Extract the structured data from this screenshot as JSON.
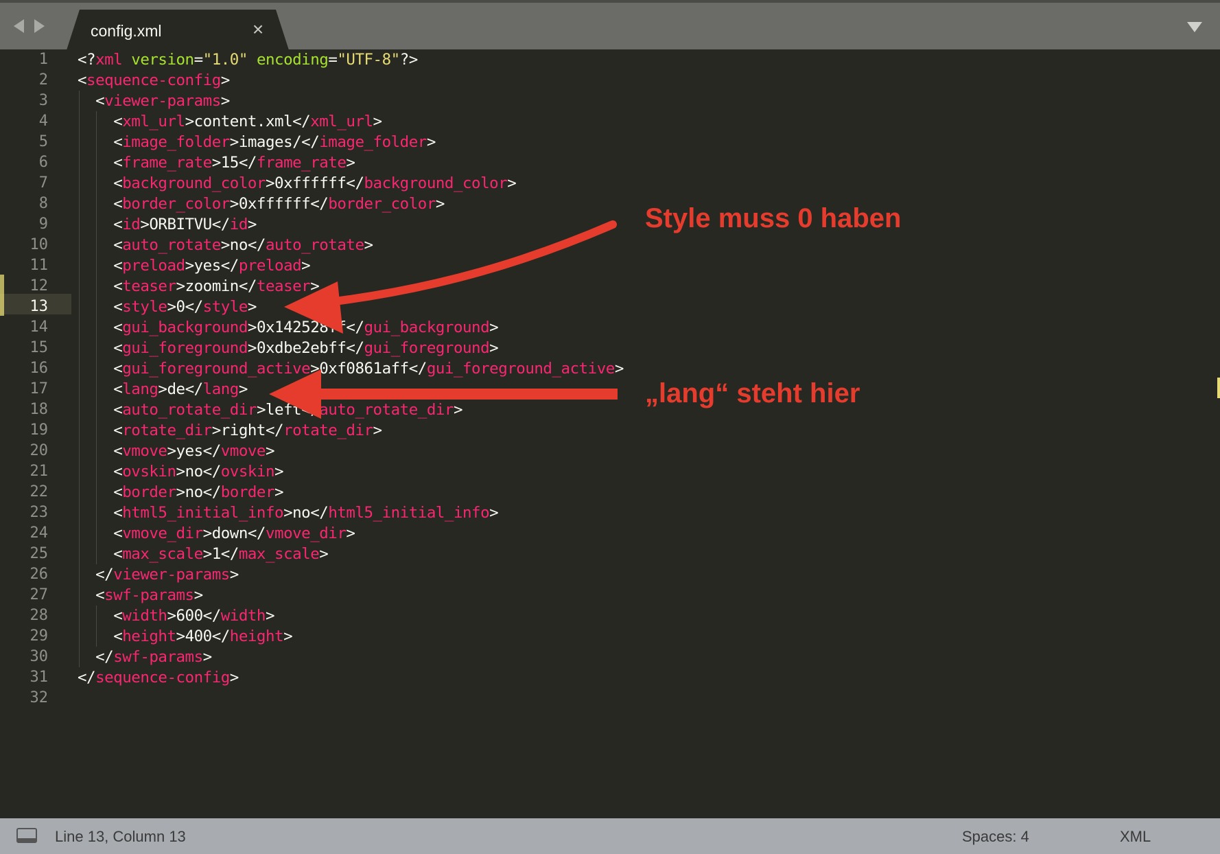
{
  "tab": {
    "title": "config.xml",
    "close_glyph": "×"
  },
  "icons": {
    "nav_back": "triangle-left-icon",
    "nav_forward": "triangle-right-icon",
    "tab_close": "close-icon",
    "tab_menu": "chevron-down-icon",
    "panel_toggle": "panel-icon",
    "arrows": "arrow-icon"
  },
  "colors": {
    "background": "#272822",
    "tag": "#f92672",
    "text": "#f8f8f2",
    "attribute": "#a6e22e",
    "string": "#e6db74",
    "line_number": "#90908a",
    "annotation": "#e63c2e"
  },
  "current_line": 13,
  "lines": [
    [
      [
        "punct",
        "<?"
      ],
      [
        "tag",
        "xml"
      ],
      [
        "text",
        " "
      ],
      [
        "attr",
        "version"
      ],
      [
        "punct",
        "="
      ],
      [
        "str",
        "\"1.0\""
      ],
      [
        "text",
        " "
      ],
      [
        "attr",
        "encoding"
      ],
      [
        "punct",
        "="
      ],
      [
        "str",
        "\"UTF-8\""
      ],
      [
        "punct",
        "?>"
      ]
    ],
    [
      [
        "punct",
        "<"
      ],
      [
        "tag",
        "sequence-config"
      ],
      [
        "punct",
        ">"
      ]
    ],
    [
      [
        "text",
        "  "
      ],
      [
        "punct",
        "<"
      ],
      [
        "tag",
        "viewer-params"
      ],
      [
        "punct",
        ">"
      ]
    ],
    [
      [
        "text",
        "    "
      ],
      [
        "punct",
        "<"
      ],
      [
        "tag",
        "xml_url"
      ],
      [
        "punct",
        ">"
      ],
      [
        "text",
        "content.xml"
      ],
      [
        "punct",
        "</"
      ],
      [
        "tag",
        "xml_url"
      ],
      [
        "punct",
        ">"
      ]
    ],
    [
      [
        "text",
        "    "
      ],
      [
        "punct",
        "<"
      ],
      [
        "tag",
        "image_folder"
      ],
      [
        "punct",
        ">"
      ],
      [
        "text",
        "images/"
      ],
      [
        "punct",
        "</"
      ],
      [
        "tag",
        "image_folder"
      ],
      [
        "punct",
        ">"
      ]
    ],
    [
      [
        "text",
        "    "
      ],
      [
        "punct",
        "<"
      ],
      [
        "tag",
        "frame_rate"
      ],
      [
        "punct",
        ">"
      ],
      [
        "text",
        "15"
      ],
      [
        "punct",
        "</"
      ],
      [
        "tag",
        "frame_rate"
      ],
      [
        "punct",
        ">"
      ]
    ],
    [
      [
        "text",
        "    "
      ],
      [
        "punct",
        "<"
      ],
      [
        "tag",
        "background_color"
      ],
      [
        "punct",
        ">"
      ],
      [
        "text",
        "0xffffff"
      ],
      [
        "punct",
        "</"
      ],
      [
        "tag",
        "background_color"
      ],
      [
        "punct",
        ">"
      ]
    ],
    [
      [
        "text",
        "    "
      ],
      [
        "punct",
        "<"
      ],
      [
        "tag",
        "border_color"
      ],
      [
        "punct",
        ">"
      ],
      [
        "text",
        "0xffffff"
      ],
      [
        "punct",
        "</"
      ],
      [
        "tag",
        "border_color"
      ],
      [
        "punct",
        ">"
      ]
    ],
    [
      [
        "text",
        "    "
      ],
      [
        "punct",
        "<"
      ],
      [
        "tag",
        "id"
      ],
      [
        "punct",
        ">"
      ],
      [
        "text",
        "ORBITVU"
      ],
      [
        "punct",
        "</"
      ],
      [
        "tag",
        "id"
      ],
      [
        "punct",
        ">"
      ]
    ],
    [
      [
        "text",
        "    "
      ],
      [
        "punct",
        "<"
      ],
      [
        "tag",
        "auto_rotate"
      ],
      [
        "punct",
        ">"
      ],
      [
        "text",
        "no"
      ],
      [
        "punct",
        "</"
      ],
      [
        "tag",
        "auto_rotate"
      ],
      [
        "punct",
        ">"
      ]
    ],
    [
      [
        "text",
        "    "
      ],
      [
        "punct",
        "<"
      ],
      [
        "tag",
        "preload"
      ],
      [
        "punct",
        ">"
      ],
      [
        "text",
        "yes"
      ],
      [
        "punct",
        "</"
      ],
      [
        "tag",
        "preload"
      ],
      [
        "punct",
        ">"
      ]
    ],
    [
      [
        "text",
        "    "
      ],
      [
        "punct",
        "<"
      ],
      [
        "tag",
        "teaser"
      ],
      [
        "punct",
        ">"
      ],
      [
        "text",
        "zoomin"
      ],
      [
        "punct",
        "</"
      ],
      [
        "tag",
        "teaser"
      ],
      [
        "punct",
        ">"
      ]
    ],
    [
      [
        "text",
        "    "
      ],
      [
        "punct",
        "<"
      ],
      [
        "tag",
        "style"
      ],
      [
        "punct",
        ">"
      ],
      [
        "text",
        "0"
      ],
      [
        "punct",
        "</"
      ],
      [
        "tag",
        "style"
      ],
      [
        "punct",
        ">"
      ]
    ],
    [
      [
        "text",
        "    "
      ],
      [
        "punct",
        "<"
      ],
      [
        "tag",
        "gui_background"
      ],
      [
        "punct",
        ">"
      ],
      [
        "text",
        "0x142528ff"
      ],
      [
        "punct",
        "</"
      ],
      [
        "tag",
        "gui_background"
      ],
      [
        "punct",
        ">"
      ]
    ],
    [
      [
        "text",
        "    "
      ],
      [
        "punct",
        "<"
      ],
      [
        "tag",
        "gui_foreground"
      ],
      [
        "punct",
        ">"
      ],
      [
        "text",
        "0xdbe2ebff"
      ],
      [
        "punct",
        "</"
      ],
      [
        "tag",
        "gui_foreground"
      ],
      [
        "punct",
        ">"
      ]
    ],
    [
      [
        "text",
        "    "
      ],
      [
        "punct",
        "<"
      ],
      [
        "tag",
        "gui_foreground_active"
      ],
      [
        "punct",
        ">"
      ],
      [
        "text",
        "0xf0861aff"
      ],
      [
        "punct",
        "</"
      ],
      [
        "tag",
        "gui_foreground_active"
      ],
      [
        "punct",
        ">"
      ]
    ],
    [
      [
        "text",
        "    "
      ],
      [
        "punct",
        "<"
      ],
      [
        "tag",
        "lang"
      ],
      [
        "punct",
        ">"
      ],
      [
        "text",
        "de"
      ],
      [
        "punct",
        "</"
      ],
      [
        "tag",
        "lang"
      ],
      [
        "punct",
        ">"
      ]
    ],
    [
      [
        "text",
        "    "
      ],
      [
        "punct",
        "<"
      ],
      [
        "tag",
        "auto_rotate_dir"
      ],
      [
        "punct",
        ">"
      ],
      [
        "text",
        "left"
      ],
      [
        "punct",
        "</"
      ],
      [
        "tag",
        "auto_rotate_dir"
      ],
      [
        "punct",
        ">"
      ]
    ],
    [
      [
        "text",
        "    "
      ],
      [
        "punct",
        "<"
      ],
      [
        "tag",
        "rotate_dir"
      ],
      [
        "punct",
        ">"
      ],
      [
        "text",
        "right"
      ],
      [
        "punct",
        "</"
      ],
      [
        "tag",
        "rotate_dir"
      ],
      [
        "punct",
        ">"
      ]
    ],
    [
      [
        "text",
        "    "
      ],
      [
        "punct",
        "<"
      ],
      [
        "tag",
        "vmove"
      ],
      [
        "punct",
        ">"
      ],
      [
        "text",
        "yes"
      ],
      [
        "punct",
        "</"
      ],
      [
        "tag",
        "vmove"
      ],
      [
        "punct",
        ">"
      ]
    ],
    [
      [
        "text",
        "    "
      ],
      [
        "punct",
        "<"
      ],
      [
        "tag",
        "ovskin"
      ],
      [
        "punct",
        ">"
      ],
      [
        "text",
        "no"
      ],
      [
        "punct",
        "</"
      ],
      [
        "tag",
        "ovskin"
      ],
      [
        "punct",
        ">"
      ]
    ],
    [
      [
        "text",
        "    "
      ],
      [
        "punct",
        "<"
      ],
      [
        "tag",
        "border"
      ],
      [
        "punct",
        ">"
      ],
      [
        "text",
        "no"
      ],
      [
        "punct",
        "</"
      ],
      [
        "tag",
        "border"
      ],
      [
        "punct",
        ">"
      ]
    ],
    [
      [
        "text",
        "    "
      ],
      [
        "punct",
        "<"
      ],
      [
        "tag",
        "html5_initial_info"
      ],
      [
        "punct",
        ">"
      ],
      [
        "text",
        "no"
      ],
      [
        "punct",
        "</"
      ],
      [
        "tag",
        "html5_initial_info"
      ],
      [
        "punct",
        ">"
      ]
    ],
    [
      [
        "text",
        "    "
      ],
      [
        "punct",
        "<"
      ],
      [
        "tag",
        "vmove_dir"
      ],
      [
        "punct",
        ">"
      ],
      [
        "text",
        "down"
      ],
      [
        "punct",
        "</"
      ],
      [
        "tag",
        "vmove_dir"
      ],
      [
        "punct",
        ">"
      ]
    ],
    [
      [
        "text",
        "    "
      ],
      [
        "punct",
        "<"
      ],
      [
        "tag",
        "max_scale"
      ],
      [
        "punct",
        ">"
      ],
      [
        "text",
        "1"
      ],
      [
        "punct",
        "</"
      ],
      [
        "tag",
        "max_scale"
      ],
      [
        "punct",
        ">"
      ]
    ],
    [
      [
        "text",
        "  "
      ],
      [
        "punct",
        "</"
      ],
      [
        "tag",
        "viewer-params"
      ],
      [
        "punct",
        ">"
      ]
    ],
    [
      [
        "text",
        "  "
      ],
      [
        "punct",
        "<"
      ],
      [
        "tag",
        "swf-params"
      ],
      [
        "punct",
        ">"
      ]
    ],
    [
      [
        "text",
        "    "
      ],
      [
        "punct",
        "<"
      ],
      [
        "tag",
        "width"
      ],
      [
        "punct",
        ">"
      ],
      [
        "text",
        "600"
      ],
      [
        "punct",
        "</"
      ],
      [
        "tag",
        "width"
      ],
      [
        "punct",
        ">"
      ]
    ],
    [
      [
        "text",
        "    "
      ],
      [
        "punct",
        "<"
      ],
      [
        "tag",
        "height"
      ],
      [
        "punct",
        ">"
      ],
      [
        "text",
        "400"
      ],
      [
        "punct",
        "</"
      ],
      [
        "tag",
        "height"
      ],
      [
        "punct",
        ">"
      ]
    ],
    [
      [
        "text",
        "  "
      ],
      [
        "punct",
        "</"
      ],
      [
        "tag",
        "swf-params"
      ],
      [
        "punct",
        ">"
      ]
    ],
    [
      [
        "punct",
        "</"
      ],
      [
        "tag",
        "sequence-config"
      ],
      [
        "punct",
        ">"
      ]
    ],
    []
  ],
  "annotations": {
    "style_note": "Style muss 0 haben",
    "lang_note": "„lang“ steht hier"
  },
  "status": {
    "cursor_position": "Line 13, Column 13",
    "indentation": "Spaces: 4",
    "syntax": "XML"
  }
}
